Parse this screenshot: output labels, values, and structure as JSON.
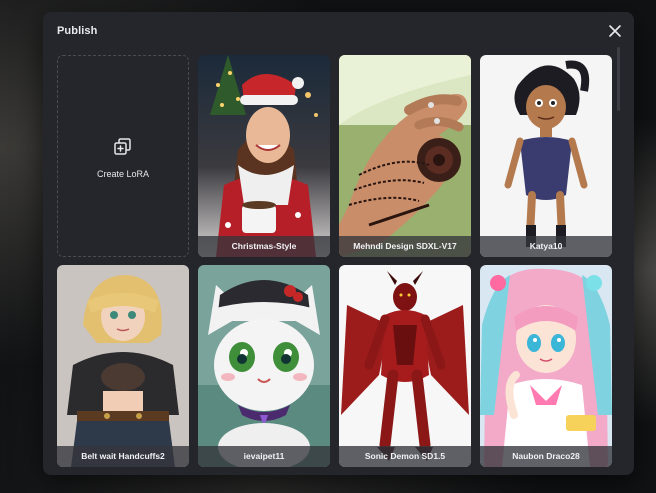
{
  "modal": {
    "title": "Publish",
    "close_icon": "close-icon"
  },
  "create_card": {
    "label": "Create LoRA",
    "icon": "add-layers-icon"
  },
  "cards": [
    {
      "label": "Christmas-Style"
    },
    {
      "label": "Mehndi Design SDXL-V17"
    },
    {
      "label": "Katya10"
    },
    {
      "label": "Belt wait Handcuffs2"
    },
    {
      "label": "ievaipet11"
    },
    {
      "label": "Sonic Demon SD1.5"
    },
    {
      "label": "Naubon Draco28"
    }
  ],
  "colors": {
    "modal_bg": "#25262b",
    "caption_bg": "#34363c",
    "text": "#e9eaee"
  }
}
